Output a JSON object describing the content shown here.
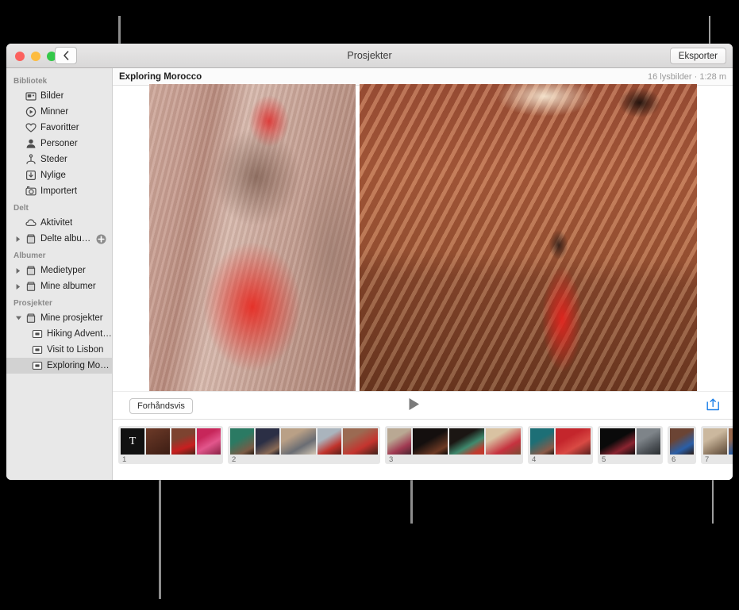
{
  "window": {
    "title": "Prosjekter",
    "export_label": "Eksporter",
    "back_icon": "chevron-left-icon",
    "traffic_lights": [
      "close",
      "minimize",
      "zoom"
    ]
  },
  "sidebar": {
    "sections": [
      {
        "header": "Bibliotek",
        "items": [
          {
            "label": "Bilder",
            "icon": "photos-icon"
          },
          {
            "label": "Minner",
            "icon": "memories-icon"
          },
          {
            "label": "Favoritter",
            "icon": "heart-icon"
          },
          {
            "label": "Personer",
            "icon": "person-icon"
          },
          {
            "label": "Steder",
            "icon": "places-pin-icon"
          },
          {
            "label": "Nylige",
            "icon": "recent-download-icon"
          },
          {
            "label": "Importert",
            "icon": "imported-camera-icon"
          }
        ]
      },
      {
        "header": "Delt",
        "items": [
          {
            "label": "Aktivitet",
            "icon": "cloud-icon"
          },
          {
            "label": "Delte albumer",
            "icon": "album-icon",
            "disclosure": "collapsed",
            "trailing_icon": "plus-circle-icon"
          }
        ]
      },
      {
        "header": "Albumer",
        "items": [
          {
            "label": "Medietyper",
            "icon": "album-icon",
            "disclosure": "collapsed"
          },
          {
            "label": "Mine albumer",
            "icon": "album-icon",
            "disclosure": "collapsed"
          }
        ]
      },
      {
        "header": "Prosjekter",
        "items": [
          {
            "label": "Mine prosjekter",
            "icon": "album-icon",
            "disclosure": "expanded"
          },
          {
            "label": "Hiking Adventure",
            "icon": "slideshow-icon",
            "indent": true
          },
          {
            "label": "Visit to Lisbon",
            "icon": "slideshow-icon",
            "indent": true
          },
          {
            "label": "Exploring Moroc...",
            "icon": "slideshow-icon",
            "indent": true,
            "selected": true
          }
        ]
      }
    ]
  },
  "content": {
    "project_name": "Exploring Morocco",
    "project_meta": "16 lysbilder · 1:28 m",
    "stage": {
      "left_photo_alt": "woman-in-red-striped-kaftan-in-alley",
      "right_photo_alt": "woman-in-red-dress-against-sunlit-wall"
    }
  },
  "player": {
    "preview_label": "Forhåndsvis",
    "play_icon": "play-icon",
    "share_icon": "export-share-icon"
  },
  "filmstrip": {
    "add_icon": "plus-circle-icon",
    "groups": [
      {
        "number": "1",
        "thumbs": [
          {
            "kind": "title",
            "text": "T"
          },
          {
            "kind": "photo",
            "tone": "t-a"
          },
          {
            "kind": "photo",
            "tone": "t-b"
          },
          {
            "kind": "photo",
            "tone": "t-c"
          }
        ]
      },
      {
        "number": "2",
        "thumbs": [
          {
            "kind": "photo",
            "tone": "t-d"
          },
          {
            "kind": "photo",
            "tone": "t-e"
          },
          {
            "kind": "photo",
            "tone": "t-f",
            "wide": true
          },
          {
            "kind": "photo",
            "tone": "t-g"
          },
          {
            "kind": "photo",
            "tone": "t-h",
            "wide": true
          }
        ]
      },
      {
        "number": "3",
        "thumbs": [
          {
            "kind": "photo",
            "tone": "t-i"
          },
          {
            "kind": "photo",
            "tone": "t-j",
            "wide": true
          },
          {
            "kind": "photo",
            "tone": "t-k",
            "wide": true
          },
          {
            "kind": "photo",
            "tone": "t-l",
            "wide": true
          }
        ]
      },
      {
        "number": "4",
        "thumbs": [
          {
            "kind": "photo",
            "tone": "t-m"
          },
          {
            "kind": "photo",
            "tone": "t-n",
            "wide": true
          }
        ]
      },
      {
        "number": "5",
        "thumbs": [
          {
            "kind": "photo",
            "tone": "t-o",
            "wide": true
          },
          {
            "kind": "photo",
            "tone": "t-p"
          }
        ]
      },
      {
        "number": "6",
        "thumbs": [
          {
            "kind": "photo",
            "tone": "t-q"
          }
        ]
      },
      {
        "number": "7",
        "thumbs": [
          {
            "kind": "photo",
            "tone": "t-r"
          },
          {
            "kind": "photo",
            "tone": "t-s"
          }
        ]
      }
    ]
  },
  "inspector_rail": {
    "icons": [
      {
        "name": "slides-icon"
      },
      {
        "name": "music-note-icon"
      },
      {
        "name": "duration-timer-icon"
      }
    ]
  },
  "colors": {
    "accent": "#1b7fe8",
    "window_chrome": "#e1e0e0",
    "sidebar_bg": "#e8e8e8",
    "selection": "#d2d2d2",
    "callout_line": "#8d8d8d",
    "backdrop": "#000000"
  }
}
